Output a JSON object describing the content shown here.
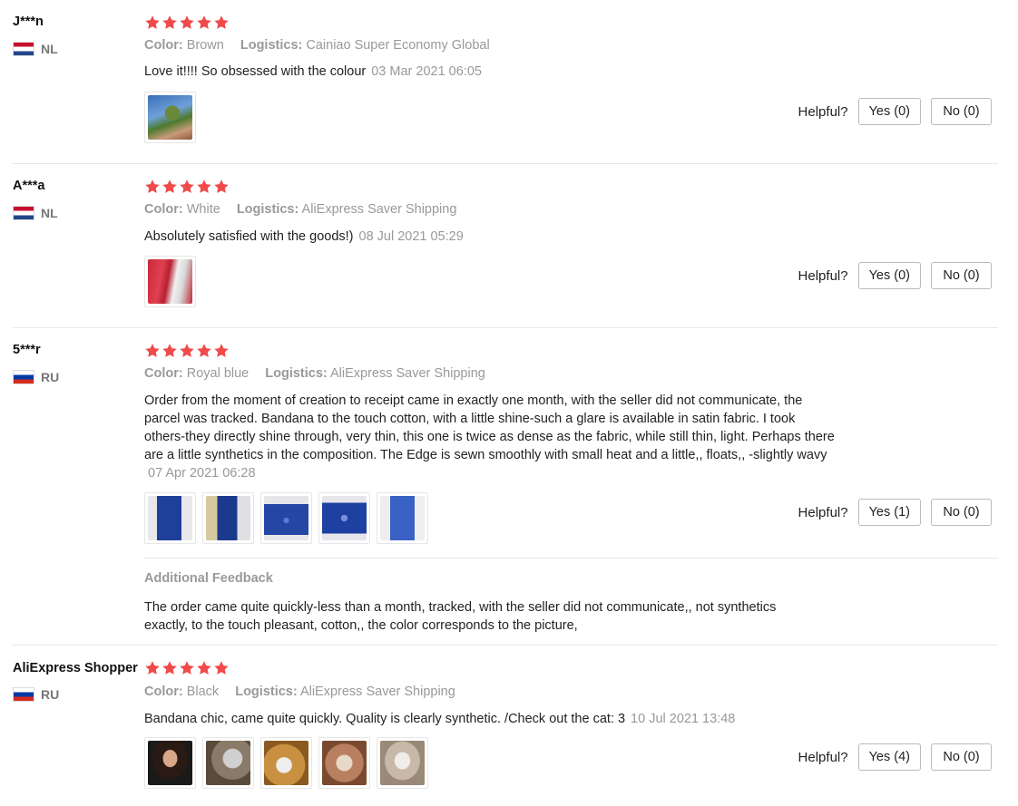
{
  "reviews": [
    {
      "buyer": "J***n",
      "country": "NL",
      "flag": "nl",
      "rating": 5,
      "color_label": "Color:",
      "color_value": "Brown",
      "logistics_label": "Logistics:",
      "logistics_value": "Cainiao Super Economy Global",
      "text": "Love it!!!! So obsessed with the colour",
      "date": "03 Mar 2021 06:05",
      "helpful_label": "Helpful?",
      "yes_label": "Yes (0)",
      "no_label": "No (0)",
      "photos": [
        "photo-woman-outdoors"
      ]
    },
    {
      "buyer": "A***a",
      "country": "NL",
      "flag": "nl",
      "rating": 5,
      "color_label": "Color:",
      "color_value": "White",
      "logistics_label": "Logistics:",
      "logistics_value": "AliExpress Saver Shipping",
      "text": "Absolutely satisfied with the goods!)",
      "date": "08 Jul 2021 05:29",
      "helpful_label": "Helpful?",
      "yes_label": "Yes (0)",
      "no_label": "No (0)",
      "photos": [
        "photo-red-bandana"
      ]
    },
    {
      "buyer": "5***r",
      "country": "RU",
      "flag": "ru",
      "rating": 5,
      "color_label": "Color:",
      "color_value": "Royal blue",
      "logistics_label": "Logistics:",
      "logistics_value": "AliExpress Saver Shipping",
      "text_lines": [
        "Order from the moment of creation to receipt came in exactly one month, with the seller did not communicate, the",
        "parcel was tracked. Bandana to the touch cotton, with a little shine-such a glare is available in satin fabric. I took",
        "others-they directly shine through, very thin, this one is twice as dense as the fabric, while still thin, light. Perhaps there",
        "are a little synthetics in the composition. The Edge is sewn smoothly with small heat and a little,, floats,, -slightly wavy"
      ],
      "date": "07 Apr 2021 06:28",
      "helpful_label": "Helpful?",
      "yes_label": "Yes (1)",
      "no_label": "No (0)",
      "photos": [
        "photo-blue-bandana-1",
        "photo-blue-bandana-2",
        "photo-blue-bandana-3",
        "photo-blue-bandana-4",
        "photo-blue-bandana-5"
      ],
      "additional_title": "Additional Feedback",
      "additional_lines": [
        "The order came quite quickly-less than a month, tracked, with the seller did not communicate,, not synthetics",
        "exactly, to the touch pleasant, cotton,, the color corresponds to the picture,"
      ]
    },
    {
      "buyer": "AliExpress Shopper",
      "country": "RU",
      "flag": "ru",
      "rating": 5,
      "color_label": "Color:",
      "color_value": "Black",
      "logistics_label": "Logistics:",
      "logistics_value": "AliExpress Saver Shipping",
      "text": "Bandana chic, came quite quickly. Quality is clearly synthetic. /Check out the cat: 3",
      "date": "10 Jul 2021 13:48",
      "helpful_label": "Helpful?",
      "yes_label": "Yes (4)",
      "no_label": "No (0)",
      "photos": [
        "photo-girl-selfie",
        "photo-cat-1",
        "photo-cat-2",
        "photo-cat-3",
        "photo-cat-4"
      ]
    }
  ],
  "colors": {
    "star": "#f04a4a",
    "muted": "#999999",
    "border": "#e8e8e8"
  }
}
